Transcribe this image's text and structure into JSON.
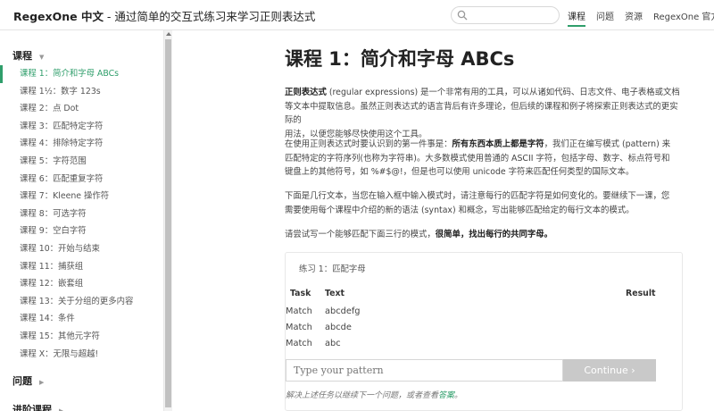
{
  "header": {
    "title_brand": "RegexOne 中文",
    "title_rest": " - 通过简单的交互式练习来学习正则表达式",
    "search_placeholder": "",
    "nav": [
      "课程",
      "问题",
      "资源",
      "RegexOne 官方网"
    ]
  },
  "sidebar": {
    "section_lessons": "课程",
    "section_problems": "问题",
    "section_advanced": "进阶课程",
    "lessons": [
      "课程 1：简介和字母 ABCs",
      "课程 1½：数字 123s",
      "课程 2：点 Dot",
      "课程 3：匹配特定字符",
      "课程 4：排除特定字符",
      "课程 5：字符范围",
      "课程 6：匹配重复字符",
      "课程 7：Kleene 操作符",
      "课程 8：可选字符",
      "课程 9：空白字符",
      "课程 10：开始与结束",
      "课程 11：捕获组",
      "课程 12：嵌套组",
      "课程 13：关于分组的更多内容",
      "课程 14：条件",
      "课程 15：其他元字符",
      "课程 X：无限与超越!"
    ]
  },
  "main": {
    "title": "课程 1：简介和字母 ABCs",
    "p1_bold": "正则表达式",
    "p1_line1": " (regular expressions) 是一个非常有用的工具，可以从诸如代码、日志文件、电子表格或文档",
    "p1_line2": "等文本中提取信息。虽然正则表达式的语言背后有许多理论，但后续的课程和例子将探索正则表达式的更实际的",
    "p1_line3": "用法，以便您能够尽快使用这个工具。",
    "p2_line1a": "在使用正则表达式时要认识到的第一件事是：",
    "p2_bold": "所有东西本质上都是字符",
    "p2_line1b": "，我们正在编写模式 (pattern) 来",
    "p2_line2": "匹配特定的字符序列(也称为字符串)。大多数模式使用普通的 ASCII 字符，包括字母、数字、标点符号和",
    "p2_line3": "键盘上的其他符号，如 %#$@!，但是也可以使用 unicode 字符来匹配任何类型的国际文本。",
    "p3_line1": "下面是几行文本，当您在输入框中输入模式时，请注意每行的匹配字符是如何变化的。要继续下一课，您",
    "p3_line2": "需要使用每个课程中介绍的新的语法 (syntax) 和概念，写出能够匹配给定的每行文本的模式。",
    "p4_text": "请尝试写一个能够匹配下面三行的模式，",
    "p4_bold": "很简单，找出每行的共同字母。"
  },
  "exercise": {
    "title": "练习 1：匹配字母",
    "col_task": "Task",
    "col_text": "Text",
    "col_result": "Result",
    "rows": [
      {
        "task": "Match",
        "text": "abcdefg"
      },
      {
        "task": "Match",
        "text": "abcde"
      },
      {
        "task": "Match",
        "text": "abc"
      }
    ],
    "input_placeholder": "Type your pattern",
    "continue_label": "Continue ›",
    "hint_text": "解决上述任务以继续下一个问题，或者查看",
    "hint_link": "答案",
    "hint_end": "。"
  }
}
